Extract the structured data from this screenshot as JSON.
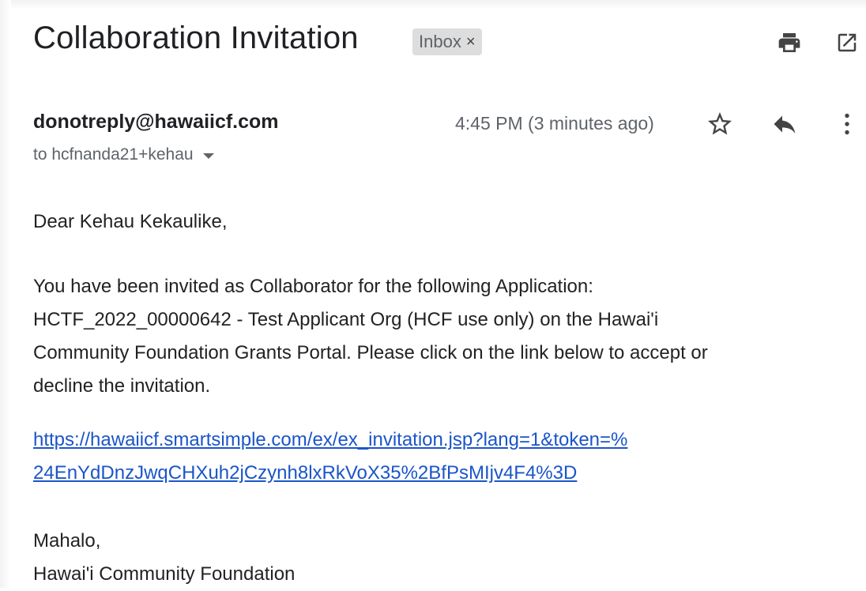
{
  "email": {
    "subject": "Collaboration Invitation",
    "label": "Inbox",
    "label_remove": "×",
    "sender": "donotreply@hawaiicf.com",
    "recipient": "to hcfnanda21+kehau",
    "time": "4:45 PM (3 minutes ago)",
    "greeting": "Dear Kehau Kekaulike,",
    "paragraph_lines": [
      "You have been invited as Collaborator for the following Application:",
      "HCTF_2022_00000642 - Test Applicant Org (HCF use only) on the  Hawai'i",
      "Community Foundation Grants Portal. Please click on the link below to accept or",
      "decline the invitation."
    ],
    "link_lines": [
      "https://hawaiicf.smartsimple.com/ex/ex_invitation.jsp?lang=1&token=%",
      "24EnYdDnzJwqCHXuh2jCzynh8lxRkVoX35%2BfPsMIjv4F4%3D"
    ],
    "closing": "Mahalo,",
    "signature": "Hawai'i Community Foundation"
  },
  "icons": {
    "print": "print-icon",
    "open_new_window": "open-in-new-window-icon",
    "star": "star-icon",
    "reply": "reply-icon",
    "more": "more-vertical-icon",
    "recipient_details": "chevron-down-icon"
  },
  "colors": {
    "link": "#1a55c9",
    "label_chip": "#dddddd",
    "secondary_text": "#5f6368"
  }
}
